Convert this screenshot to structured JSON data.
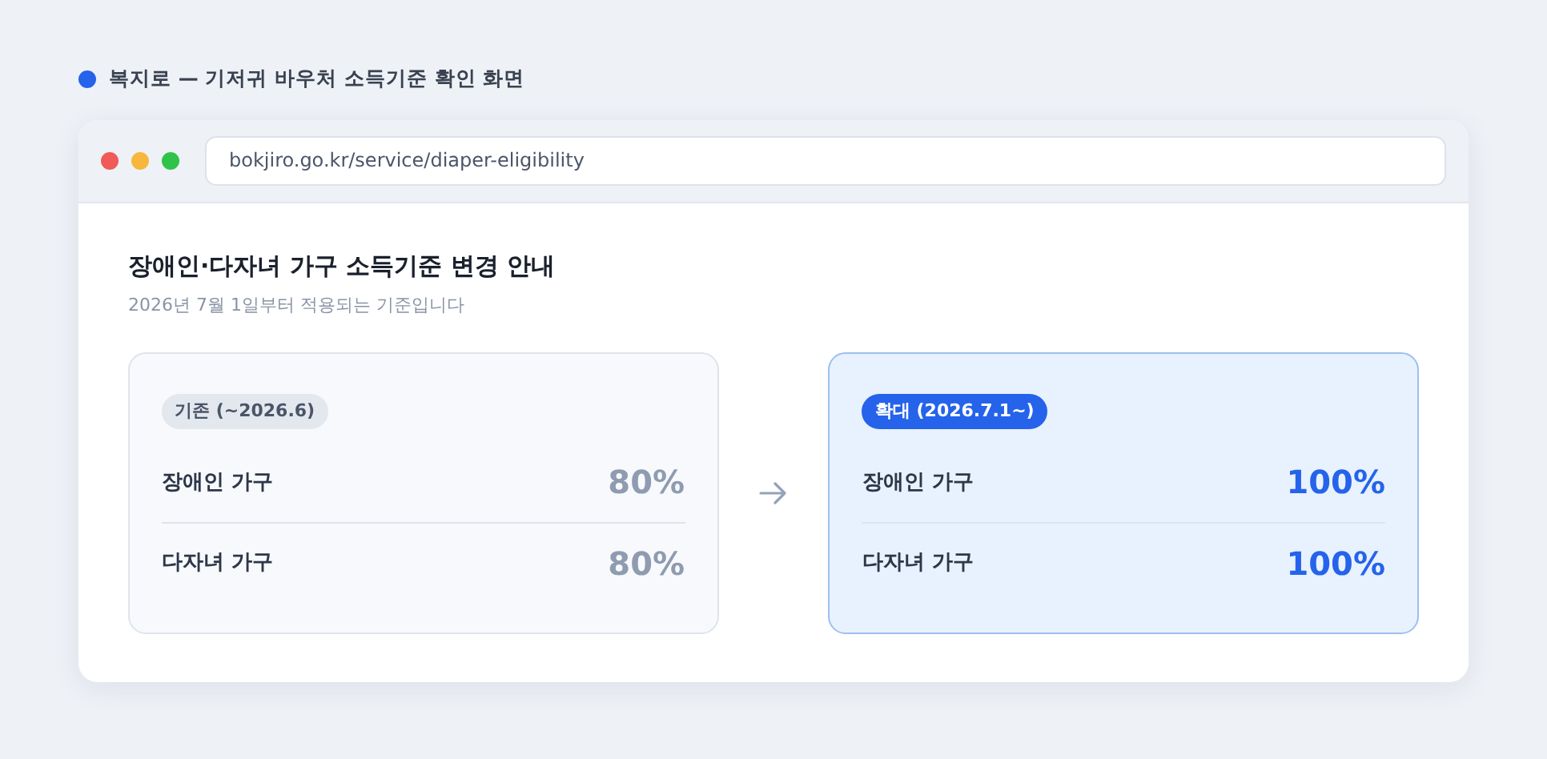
{
  "caption": "복지로 — 기저귀 바우처 소득기준 확인 화면",
  "browser": {
    "address": "bokjiro.go.kr/service/diaper-eligibility"
  },
  "page": {
    "title": "장애인·다자녀 가구 소득기준 변경 안내",
    "subtitle": "2026년 7월 1일부터 적용되는 기준입니다"
  },
  "panels": [
    {
      "kind": "before",
      "badge": "기존 (~2026.6)",
      "rows": [
        {
          "label": "장애인 가구",
          "value": "80%"
        },
        {
          "label": "다자녀 가구",
          "value": "80%"
        }
      ]
    },
    {
      "kind": "after",
      "badge": "확대 (2026.7.1~)",
      "rows": [
        {
          "label": "장애인 가구",
          "value": "100%"
        },
        {
          "label": "다자녀 가구",
          "value": "100%"
        }
      ]
    }
  ]
}
